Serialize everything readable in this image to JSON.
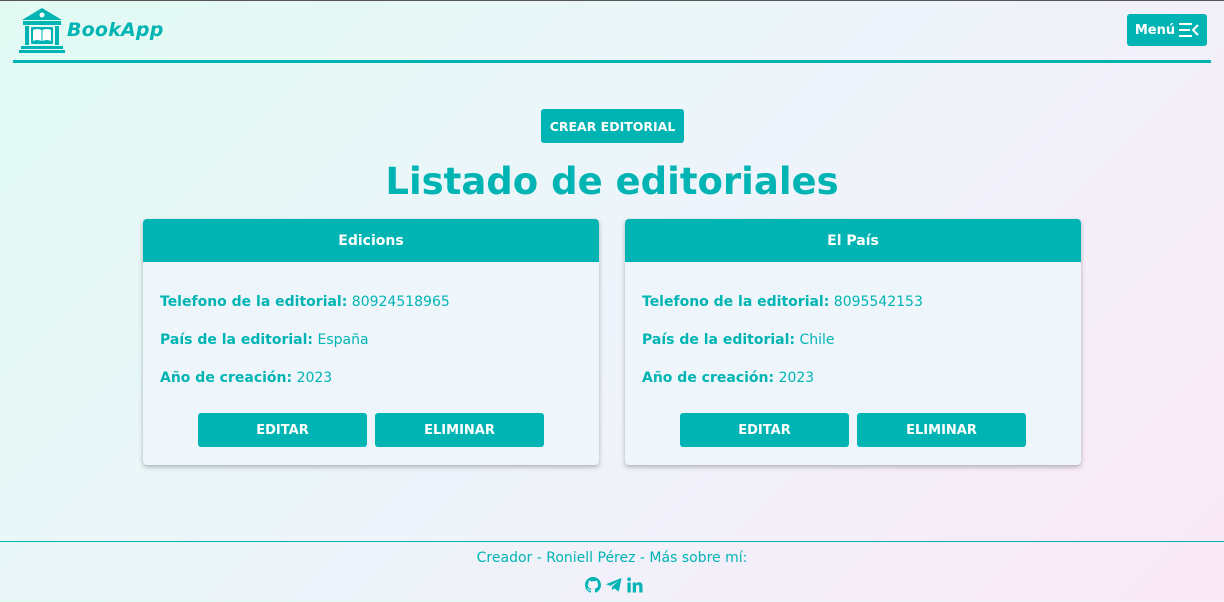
{
  "header": {
    "brand_name": "BookApp",
    "menu_label": "Menú"
  },
  "main": {
    "create_button": "CREAR EDITORIAL",
    "title": "Listado de editoriales",
    "labels": {
      "phone": "Telefono de la editorial:",
      "country": "País de la editorial:",
      "year": "Año de creación:"
    },
    "cards": [
      {
        "name": "Edicions",
        "phone": "80924518965",
        "country": "España",
        "year": "2023",
        "edit_label": "EDITAR",
        "delete_label": "ELIMINAR"
      },
      {
        "name": "El País",
        "phone": "8095542153",
        "country": "Chile",
        "year": "2023",
        "edit_label": "EDITAR",
        "delete_label": "ELIMINAR"
      }
    ]
  },
  "footer": {
    "text": "Creador - Roniell Pérez - Más sobre mí:",
    "social_icons": [
      "github-icon",
      "telegram-icon",
      "linkedin-icon"
    ]
  },
  "colors": {
    "accent": "#00b4b4",
    "card_background": "#eef6fc",
    "button_text": "#ffffff"
  }
}
